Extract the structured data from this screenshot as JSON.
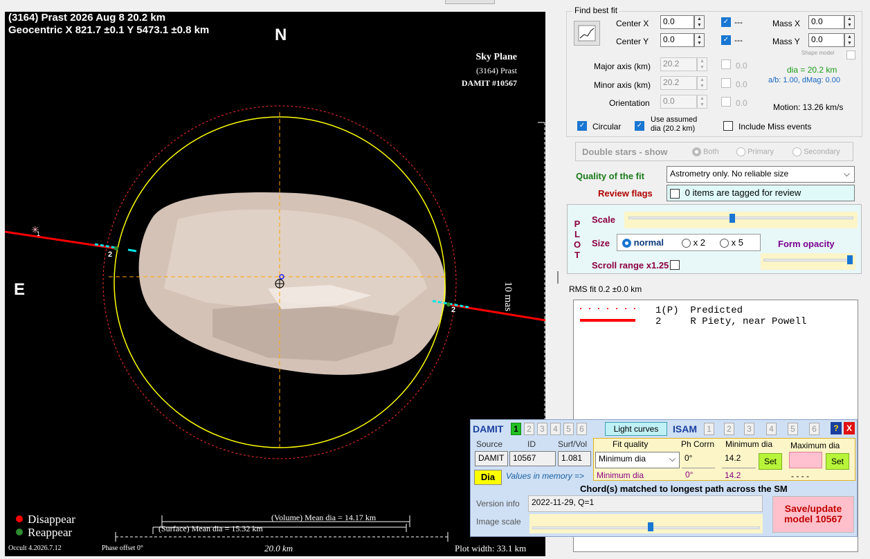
{
  "plot": {
    "header_line1": "(3164) Prast  2026 Aug 8   20.2 km",
    "header_line2": "Geocentric X  821.7 ±0.1  Y 5473.1 ±0.8 km",
    "north": "N",
    "east": "E",
    "sky_plane": [
      "Sky Plane",
      "(3164) Prast",
      "DAMIT #10567"
    ],
    "scale_mas": "10 mas",
    "legend_disappear": "Disappear",
    "legend_reappear": "Reappear",
    "volume_dia": "(Volume) Mean dia = 14.17 km",
    "surface_dia": "(Surface) Mean dia = 15.32 km",
    "scale_km": "20.0 km",
    "version": "Occult 4.2026.7.12",
    "phase_offset": "Phase offset 0°",
    "plot_width": "Plot width: 33.1 km",
    "chord_label_1": "1",
    "chord_label_2a": "2",
    "chord_label_2b": "2",
    "colors": {
      "disappear": "#ff0000",
      "reappear": "#2e8b2e",
      "chord": "#ff0000",
      "limb": "#ffff00",
      "predicted": "#ff3030",
      "axes": "#ffa500"
    }
  },
  "fit": {
    "group_title": "Find best fit",
    "center_x_label": "Center X",
    "center_x": "0.0",
    "center_y_label": "Center Y",
    "center_y": "0.0",
    "mass_x_label": "Mass X",
    "mass_x": "0.0",
    "mass_y_label": "Mass Y",
    "mass_y": "0.0",
    "dash1": "---",
    "dash2": "---",
    "shape_model": "Shape model",
    "major_label": "Major axis (km)",
    "major": "20.2",
    "major_v": "0.0",
    "minor_label": "Minor axis (km)",
    "minor": "20.2",
    "minor_v": "0.0",
    "orient_label": "Orientation",
    "orient": "0.0",
    "orient_v": "0.0",
    "dia": "dia = 20.2 km",
    "ab": "a/b: 1.00, dMag: 0.00",
    "motion": "Motion: 13.26 km/s",
    "circular": "Circular",
    "use_assumed_1": "Use assumed",
    "use_assumed_2": "dia (20.2 km)",
    "include_miss": "Include Miss events",
    "double_stars": "Double stars - show",
    "both": "Both",
    "primary": "Primary",
    "secondary": "Secondary",
    "quality_label": "Quality of the fit",
    "quality_value": "Astrometry only. No reliable size",
    "review_label": "Review flags",
    "review_value": "0 items are tagged for review"
  },
  "plotctl": {
    "plot_letters": [
      "P",
      "L",
      "O",
      "T"
    ],
    "scale": "Scale",
    "size": "Size",
    "normal": "normal",
    "x2": "x 2",
    "x5": "x 5",
    "form_opacity": "Form opacity",
    "scroll_range": "Scroll range x1.25",
    "scale_level": 0.46,
    "opacity_level": 1.0
  },
  "rms": "RMS fit 0.2 ±0.0 km",
  "legend_list": [
    {
      "num": "1(P)",
      "name": "Predicted"
    },
    {
      "num": "2",
      "name": "R Piety, near Powell"
    }
  ],
  "damit": {
    "title": "DAMIT",
    "tabs": [
      "1",
      "2",
      "3",
      "4",
      "5",
      "6"
    ],
    "light_curves": "Light curves",
    "isam": "ISAM",
    "isam_tabs": [
      "1",
      "2",
      "3",
      "4",
      "5",
      "6"
    ],
    "help": "?",
    "close": "X",
    "h_source": "Source",
    "h_id": "ID",
    "h_surf": "Surf/Vol",
    "h_fitq": "Fit quality",
    "h_phcorr": "Ph Corrn",
    "h_min": "Minimum dia",
    "h_max": "Maximum dia",
    "source": "DAMIT",
    "id": "10567",
    "surf": "1.081",
    "fitq": "Minimum dia",
    "phcorr": "0°",
    "min": "14.2",
    "max": "",
    "set": "Set",
    "dia_btn": "Dia",
    "values_memory": "Values in memory =>",
    "mem_fitq": "Minimum dia",
    "mem_ph": "0°",
    "mem_min": "14.2",
    "mem_max": "- - - -",
    "chords_matched": "Chord(s) matched to longest path across the SM",
    "version_label": "Version info",
    "version_value": "2022-11-29, Q=1",
    "image_scale": "Image scale",
    "save_1": "Save/update",
    "save_2": "model 10567",
    "image_scale_level": 0.52
  }
}
